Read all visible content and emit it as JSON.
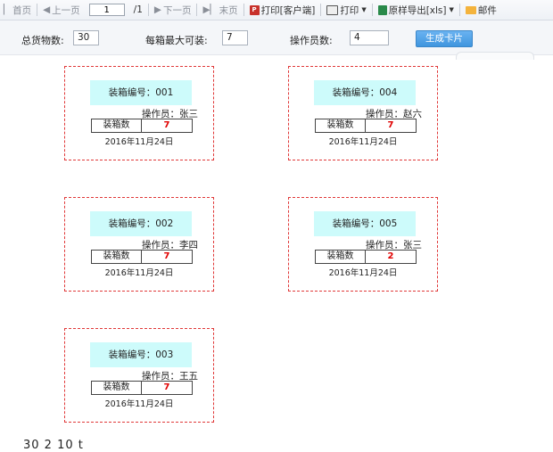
{
  "toolbar": {
    "first": "首页",
    "prev": "上一页",
    "page_value": "1",
    "page_total": "/1",
    "next": "下一页",
    "last": "末页",
    "print_client": "打印[客户端]",
    "print": "打印",
    "export": "原样导出[xls]",
    "mail": "邮件"
  },
  "params": {
    "total_label": "总货物数:",
    "total_value": "30",
    "max_label": "每箱最大可装:",
    "max_value": "7",
    "operators_label": "操作员数:",
    "operators_value": "4",
    "generate_label": "生成卡片"
  },
  "cards": [
    {
      "box_no": "装箱编号：001",
      "operator": "操作员：张三",
      "count_label": "装箱数",
      "count": "7",
      "date": "2016年11月24日"
    },
    {
      "box_no": "装箱编号：004",
      "operator": "操作员：赵六",
      "count_label": "装箱数",
      "count": "7",
      "date": "2016年11月24日"
    },
    {
      "box_no": "装箱编号：002",
      "operator": "操作员：李四",
      "count_label": "装箱数",
      "count": "7",
      "date": "2016年11月24日"
    },
    {
      "box_no": "装箱编号：005",
      "operator": "操作员：张三",
      "count_label": "装箱数",
      "count": "2",
      "date": "2016年11月24日"
    },
    {
      "box_no": "装箱编号：003",
      "operator": "操作员：王五",
      "count_label": "装箱数",
      "count": "7",
      "date": "2016年11月24日"
    }
  ],
  "footer": "30  2  10  t"
}
